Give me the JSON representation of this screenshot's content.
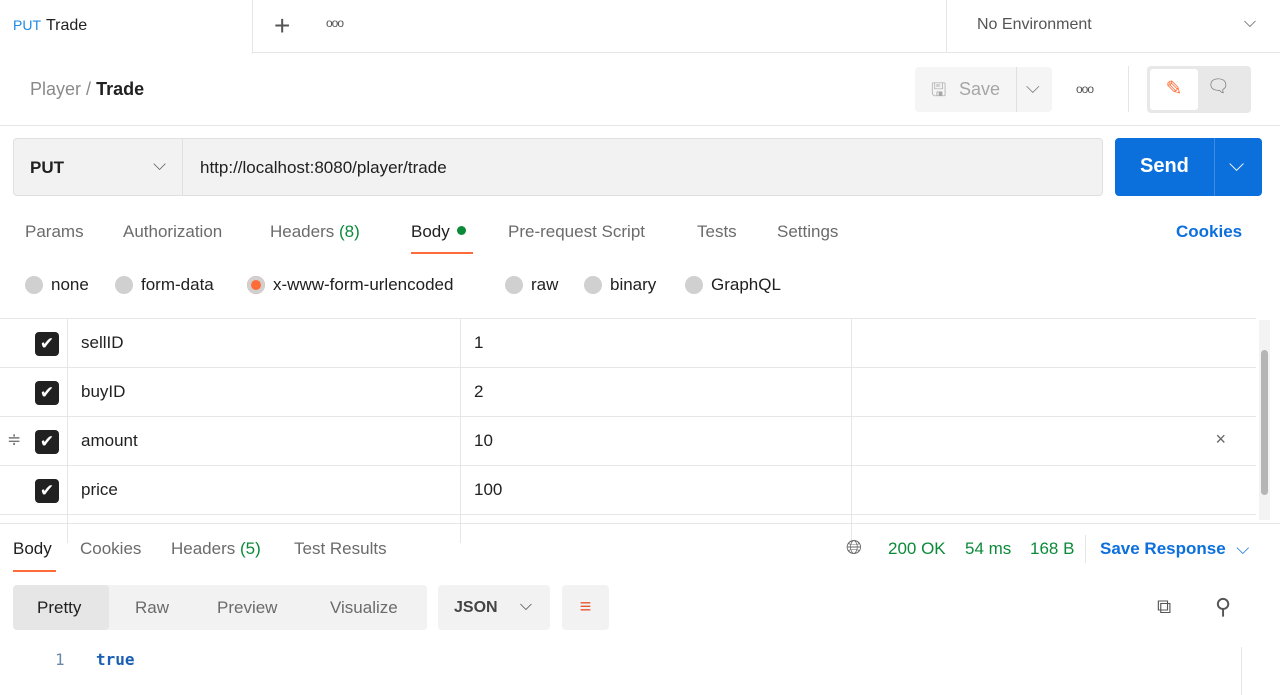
{
  "tabs": [
    {
      "method": "PUT",
      "name": "Trade"
    }
  ],
  "tab_actions": {
    "new": "+",
    "more": "ooo"
  },
  "environment": "No Environment",
  "breadcrumb": {
    "parent": "Player",
    "separator": "/",
    "current": "Trade"
  },
  "toolbar": {
    "save_label": "Save"
  },
  "request": {
    "method": "PUT",
    "url": "http://localhost:8080/player/trade",
    "send_label": "Send"
  },
  "request_tabs": [
    {
      "label": "Params"
    },
    {
      "label": "Authorization"
    },
    {
      "label": "Headers",
      "count": "(8)"
    },
    {
      "label": "Body",
      "active": true
    },
    {
      "label": "Pre-request Script"
    },
    {
      "label": "Tests"
    },
    {
      "label": "Settings"
    }
  ],
  "cookies_label": "Cookies",
  "body_types": [
    {
      "label": "none"
    },
    {
      "label": "form-data"
    },
    {
      "label": "x-www-form-urlencoded",
      "selected": true
    },
    {
      "label": "raw"
    },
    {
      "label": "binary"
    },
    {
      "label": "GraphQL"
    }
  ],
  "params": [
    {
      "key": "sellID",
      "value": "1",
      "checked": true
    },
    {
      "key": "buyID",
      "value": "2",
      "checked": true
    },
    {
      "key": "amount",
      "value": "10",
      "checked": true
    },
    {
      "key": "price",
      "value": "100",
      "checked": true
    }
  ],
  "response_tabs": [
    {
      "label": "Body",
      "active": true
    },
    {
      "label": "Cookies"
    },
    {
      "label": "Headers",
      "count": "(5)"
    },
    {
      "label": "Test Results"
    }
  ],
  "status": {
    "code": "200 OK",
    "time": "54 ms",
    "size": "168 B"
  },
  "save_response_label": "Save Response",
  "view_modes": [
    "Pretty",
    "Raw",
    "Preview",
    "Visualize"
  ],
  "format": "JSON",
  "response_body": [
    {
      "line": "1",
      "text": "true"
    }
  ],
  "colors": {
    "accent": "#ff6c37",
    "send": "#0b6fdc",
    "link": "#0b6fdc",
    "success": "#0b8a3a"
  }
}
